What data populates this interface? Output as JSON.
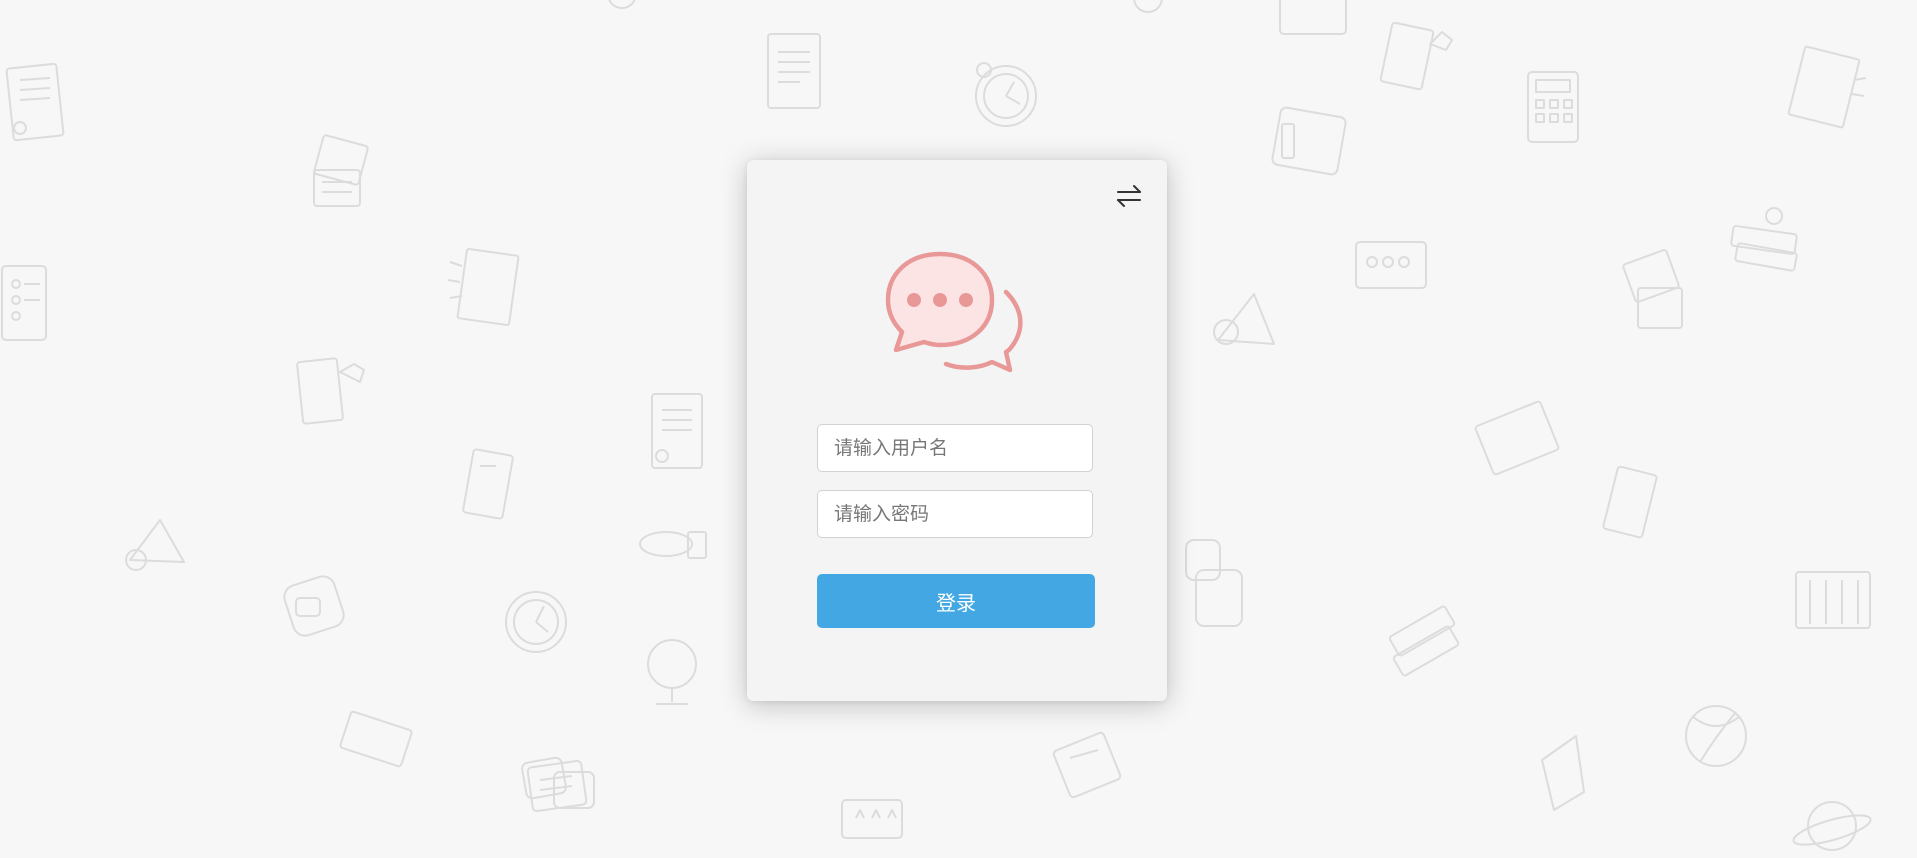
{
  "login": {
    "username_placeholder": "请输入用户名",
    "password_placeholder": "请输入密码",
    "login_button": "登录"
  },
  "icons": {
    "switch": "switch-arrows-icon",
    "logo": "chat-bubbles-icon"
  },
  "colors": {
    "page_background": "#f7f7f7",
    "card_background": "#f4f4f4",
    "button": "#42a7e3",
    "logo_stroke": "#e99898",
    "logo_fill": "#fde4e4"
  }
}
